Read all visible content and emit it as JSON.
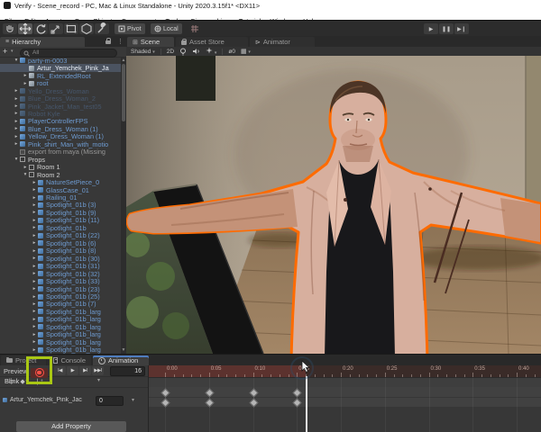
{
  "window": {
    "title": "Verify - Scene_record - PC, Mac & Linux Standalone - Unity 2020.3.15f1* <DX11>",
    "menus": [
      "File",
      "Edit",
      "Assets",
      "GameObject",
      "Component",
      "Tools",
      "Cinemachine",
      "Tutorial",
      "Window",
      "Help"
    ]
  },
  "main_toolbar": {
    "tools": [
      "hand-tool",
      "move-tool",
      "rotate-tool",
      "scale-tool",
      "rect-tool",
      "transform-tool",
      "custom-tool"
    ],
    "active_tool": "move-tool",
    "pivot_label": "Pivot",
    "local_label": "Local",
    "play_controls": [
      "play",
      "pause",
      "step"
    ]
  },
  "hierarchy": {
    "tab_label": "Hierarchy",
    "create_button": "+",
    "search_placeholder": "All",
    "items": [
      {
        "label": "party-m-0003",
        "depth": 0,
        "disclosure": "expanded",
        "icon": "prefab",
        "style": "prefab",
        "sub_arrow": true
      },
      {
        "label": "Artur_Yemchek_Pink_Ja",
        "depth": 1,
        "disclosure": "none",
        "icon": "model",
        "style": "selected",
        "sub_arrow": false
      },
      {
        "label": "RL_ExtendedRoot",
        "depth": 1,
        "disclosure": "collapsed",
        "icon": "model",
        "style": "prefab",
        "sub_arrow": false
      },
      {
        "label": "root",
        "depth": 1,
        "disclosure": "collapsed",
        "icon": "model",
        "style": "prefab",
        "sub_arrow": false
      },
      {
        "label": "Yello_Dress_Woman",
        "depth": 0,
        "disclosure": "collapsed",
        "icon": "prefab",
        "style": "inactive",
        "sub_arrow": false
      },
      {
        "label": "Blue_Dress_Woman_2",
        "depth": 0,
        "disclosure": "collapsed",
        "icon": "prefab",
        "style": "inactive",
        "sub_arrow": false
      },
      {
        "label": "Pink_Jacket_Man_test05",
        "depth": 0,
        "disclosure": "collapsed",
        "icon": "prefab",
        "style": "inactive",
        "sub_arrow": false
      },
      {
        "label": "Robot Kyle",
        "depth": 0,
        "disclosure": "collapsed",
        "icon": "prefab",
        "style": "inactive",
        "sub_arrow": false
      },
      {
        "label": "PlayerControllerFPS",
        "depth": 0,
        "disclosure": "collapsed",
        "icon": "prefab",
        "style": "prefab",
        "sub_arrow": true
      },
      {
        "label": "Blue_Dress_Woman (1)",
        "depth": 0,
        "disclosure": "collapsed",
        "icon": "prefab",
        "style": "prefab",
        "sub_arrow": false
      },
      {
        "label": "Yellow_Dress_Woman (1)",
        "depth": 0,
        "disclosure": "collapsed",
        "icon": "prefab",
        "style": "prefab",
        "sub_arrow": false
      },
      {
        "label": "Pink_shirt_Man_with_motio",
        "depth": 0,
        "disclosure": "collapsed",
        "icon": "prefab",
        "style": "prefab",
        "sub_arrow": false
      },
      {
        "label": "export from maya (Missing",
        "depth": 0,
        "disclosure": "none",
        "icon": "missing",
        "style": "missing",
        "sub_arrow": false
      },
      {
        "label": "Props",
        "depth": 0,
        "disclosure": "expanded",
        "icon": "plain",
        "style": "plain",
        "sub_arrow": false
      },
      {
        "label": "Room 1",
        "depth": 1,
        "disclosure": "collapsed",
        "icon": "plain",
        "style": "plain",
        "sub_arrow": false
      },
      {
        "label": "Room 2",
        "depth": 1,
        "disclosure": "expanded",
        "icon": "plain",
        "style": "plain",
        "sub_arrow": false
      },
      {
        "label": "NatureSetPiece_0",
        "depth": 2,
        "disclosure": "collapsed",
        "icon": "prefab",
        "style": "prefab",
        "sub_arrow": true
      },
      {
        "label": "GlassCase_01",
        "depth": 2,
        "disclosure": "collapsed",
        "icon": "prefab",
        "style": "prefab",
        "sub_arrow": true
      },
      {
        "label": "Railing_01",
        "depth": 2,
        "disclosure": "collapsed",
        "icon": "prefab",
        "style": "prefab",
        "sub_arrow": true
      },
      {
        "label": "Spotlight_01b (3)",
        "depth": 2,
        "disclosure": "collapsed",
        "icon": "prefab",
        "style": "prefab",
        "sub_arrow": true
      },
      {
        "label": "Spotlight_01b (9)",
        "depth": 2,
        "disclosure": "collapsed",
        "icon": "prefab",
        "style": "prefab",
        "sub_arrow": true
      },
      {
        "label": "Spotlight_01b (11)",
        "depth": 2,
        "disclosure": "collapsed",
        "icon": "prefab",
        "style": "prefab",
        "sub_arrow": true
      },
      {
        "label": "Spotlight_01b",
        "depth": 2,
        "disclosure": "collapsed",
        "icon": "prefab",
        "style": "prefab",
        "sub_arrow": true
      },
      {
        "label": "Spotlight_01b (22)",
        "depth": 2,
        "disclosure": "collapsed",
        "icon": "prefab",
        "style": "prefab",
        "sub_arrow": true
      },
      {
        "label": "Spotlight_01b (6)",
        "depth": 2,
        "disclosure": "collapsed",
        "icon": "prefab",
        "style": "prefab",
        "sub_arrow": true
      },
      {
        "label": "Spotlight_01b (8)",
        "depth": 2,
        "disclosure": "collapsed",
        "icon": "prefab",
        "style": "prefab",
        "sub_arrow": true
      },
      {
        "label": "Spotlight_01b (30)",
        "depth": 2,
        "disclosure": "collapsed",
        "icon": "prefab",
        "style": "prefab",
        "sub_arrow": true
      },
      {
        "label": "Spotlight_01b (31)",
        "depth": 2,
        "disclosure": "collapsed",
        "icon": "prefab",
        "style": "prefab",
        "sub_arrow": true
      },
      {
        "label": "Spotlight_01b (32)",
        "depth": 2,
        "disclosure": "collapsed",
        "icon": "prefab",
        "style": "prefab",
        "sub_arrow": true
      },
      {
        "label": "Spotlight_01b (33)",
        "depth": 2,
        "disclosure": "collapsed",
        "icon": "prefab",
        "style": "prefab",
        "sub_arrow": true
      },
      {
        "label": "Spotlight_01b (23)",
        "depth": 2,
        "disclosure": "collapsed",
        "icon": "prefab",
        "style": "prefab",
        "sub_arrow": true
      },
      {
        "label": "Spotlight_01b (25)",
        "depth": 2,
        "disclosure": "collapsed",
        "icon": "prefab",
        "style": "prefab",
        "sub_arrow": true
      },
      {
        "label": "Spotlight_01b (7)",
        "depth": 2,
        "disclosure": "collapsed",
        "icon": "prefab",
        "style": "prefab",
        "sub_arrow": true
      },
      {
        "label": "Spotlight_01b_larg",
        "depth": 2,
        "disclosure": "collapsed",
        "icon": "prefab",
        "style": "prefab",
        "sub_arrow": true
      },
      {
        "label": "Spotlight_01b_larg",
        "depth": 2,
        "disclosure": "collapsed",
        "icon": "prefab",
        "style": "prefab",
        "sub_arrow": true
      },
      {
        "label": "Spotlight_01b_larg",
        "depth": 2,
        "disclosure": "collapsed",
        "icon": "prefab",
        "style": "prefab",
        "sub_arrow": true
      },
      {
        "label": "Spotlight_01b_larg",
        "depth": 2,
        "disclosure": "collapsed",
        "icon": "prefab",
        "style": "prefab",
        "sub_arrow": true
      },
      {
        "label": "Spotlight_01b_larg",
        "depth": 2,
        "disclosure": "collapsed",
        "icon": "prefab",
        "style": "prefab",
        "sub_arrow": true
      },
      {
        "label": "Spotlight_01b_larg",
        "depth": 2,
        "disclosure": "collapsed",
        "icon": "prefab",
        "style": "prefab",
        "sub_arrow": true
      }
    ]
  },
  "scene_view": {
    "tabs": [
      {
        "label": "Scene",
        "active": true
      },
      {
        "label": "Asset Store",
        "active": false
      },
      {
        "label": "Animator",
        "active": false
      }
    ],
    "toolbar": {
      "shading_mode": "Shaded",
      "mode_2d": "2D",
      "visibility_count": "ø0"
    }
  },
  "animation_panel": {
    "tabs": [
      {
        "label": "Project",
        "active": false
      },
      {
        "label": "Console",
        "active": false
      },
      {
        "label": "Animation",
        "active": true
      }
    ],
    "preview_label": "Preview",
    "frame_field": "16",
    "clip_dropdown": "Blink",
    "ruler_labels": [
      "0:00",
      "0:05",
      "0:10",
      "0:15",
      "0:20",
      "0:25",
      "0:30",
      "0:35",
      "0:40"
    ],
    "keyframe_rows": [
      [
        0,
        5,
        10,
        15
      ],
      [
        0,
        5,
        10,
        15
      ]
    ],
    "playhead_frame": 16,
    "property": {
      "name": "Artur_Yemchek_Pink_Jacke",
      "value": "0"
    },
    "add_property_label": "Add Property"
  },
  "colors": {
    "selection_outline": "#ff6b00",
    "record_red": "#ff5147",
    "tutorial_highlight_green": "#a9c714",
    "prefab_text_blue": "#6e9bd1",
    "ruler_record_tint": "#5c322e"
  }
}
